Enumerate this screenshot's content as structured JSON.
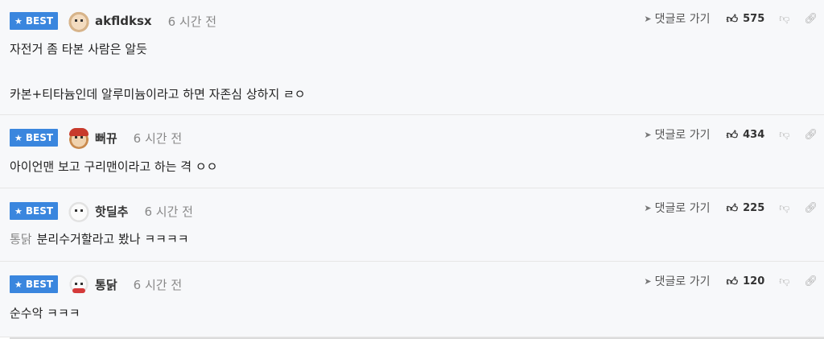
{
  "ui": {
    "best_label": "BEST",
    "goto_label": "댓글로 가기",
    "colors": {
      "badge": "#3a86de",
      "row_bg": "#f7f8fa"
    }
  },
  "comments": [
    {
      "nick": "akfldksx",
      "time": "6 시간 전",
      "likes": "575",
      "lines": [
        "자전거 좀 타본 사람은 알듯",
        "카본+티타늄인데 알루미늄이라고 하면 자존심 상하지 ㄹㅇ"
      ],
      "avatar": "dog-icon"
    },
    {
      "nick": "뻐뀨",
      "time": "6 시간 전",
      "likes": "434",
      "text": "아이언맨 보고 구리맨이라고 하는 격 ㅇㅇ",
      "avatar": "dog-red-hat-icon"
    },
    {
      "nick": "핫딜추",
      "time": "6 시간 전",
      "likes": "225",
      "mention": "통닭",
      "text": "분리수거할라고 봤나 ㅋㅋㅋㅋ",
      "avatar": "white-dog-icon"
    },
    {
      "nick": "통닭",
      "time": "6 시간 전",
      "likes": "120",
      "text": "순수악 ㅋㅋㅋ",
      "avatar": "polar-bear-icon"
    }
  ]
}
